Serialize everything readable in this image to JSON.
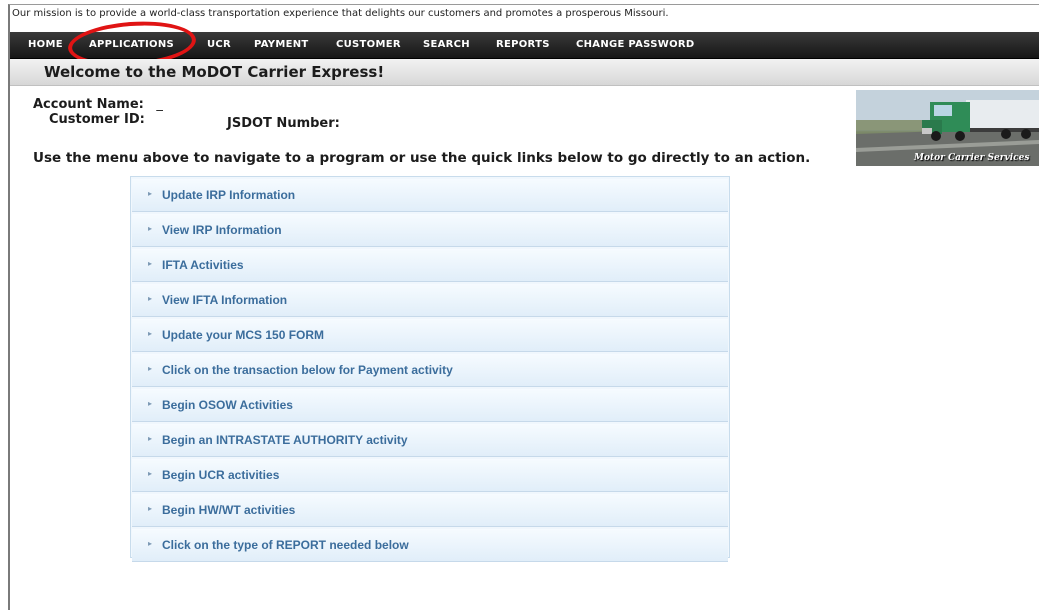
{
  "mission": "Our mission is to provide a world-class transportation experience that delights our customers and promotes a prosperous Missouri.",
  "nav": [
    {
      "label": "HOME"
    },
    {
      "label": "APPLICATIONS"
    },
    {
      "label": "UCR"
    },
    {
      "label": "PAYMENT"
    },
    {
      "label": "CUSTOMER"
    },
    {
      "label": "SEARCH"
    },
    {
      "label": "REPORTS"
    },
    {
      "label": "CHANGE PASSWORD"
    }
  ],
  "welcome": "Welcome to the MoDOT Carrier Express!",
  "account": {
    "name_label": "Account Name:",
    "name_value": "_",
    "customer_id_label": "Customer ID:",
    "usdot_label": "JSDOT Number:"
  },
  "truck_caption": "Motor Carrier Services",
  "instructions": "Use the menu above to navigate to a program or use the quick links below to go directly to an action.",
  "quick_links": [
    {
      "label": "Update IRP Information"
    },
    {
      "label": "View IRP Information"
    },
    {
      "label": "IFTA Activities"
    },
    {
      "label": "View IFTA Information"
    },
    {
      "label": "Update your MCS 150 FORM"
    },
    {
      "label": "Click on the transaction below for Payment activity"
    },
    {
      "label": "Begin OSOW Activities"
    },
    {
      "label": "Begin an INTRASTATE AUTHORITY activity"
    },
    {
      "label": "Begin UCR activities"
    },
    {
      "label": "Begin HW/WT activities"
    },
    {
      "label": "Click on the type of REPORT needed below"
    }
  ],
  "colors": {
    "nav_bg": "#1e1e1e",
    "highlight": "#e01414",
    "link_text": "#3b6d9c",
    "link_bg": "#e8f2fb"
  }
}
